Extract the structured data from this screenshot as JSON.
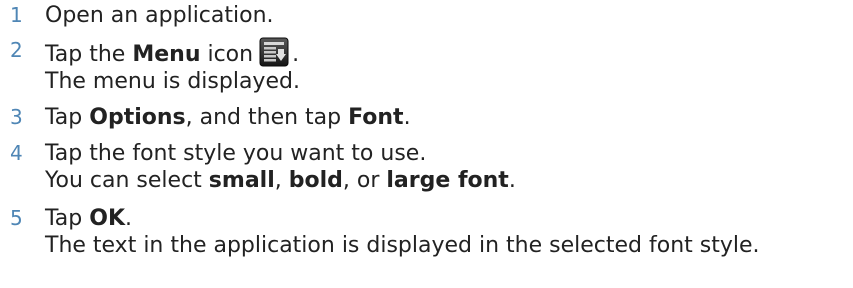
{
  "steps": [
    {
      "number": "1",
      "line1": "Open an application."
    },
    {
      "number": "2",
      "pre": "Tap the ",
      "bold1": "Menu",
      "post": " icon",
      "after_icon": ".",
      "line2": "The menu is displayed.",
      "icon": "menu-icon"
    },
    {
      "number": "3",
      "pre": "Tap ",
      "bold1": "Options",
      "mid": ", and then tap ",
      "bold2": "Font",
      "end": "."
    },
    {
      "number": "4",
      "line1": "Tap the font style you want to use.",
      "pre2": "You can select ",
      "bold_a": "small",
      "sep_a": ", ",
      "bold_b": "bold",
      "sep_b": ", or ",
      "bold_c": "large font",
      "end2": "."
    },
    {
      "number": "5",
      "pre": "Tap ",
      "bold1": "OK",
      "end": ".",
      "line2": "The text in the application is displayed in the selected font style."
    }
  ],
  "colors": {
    "step_number": "#4f86b5",
    "text": "#222222"
  }
}
